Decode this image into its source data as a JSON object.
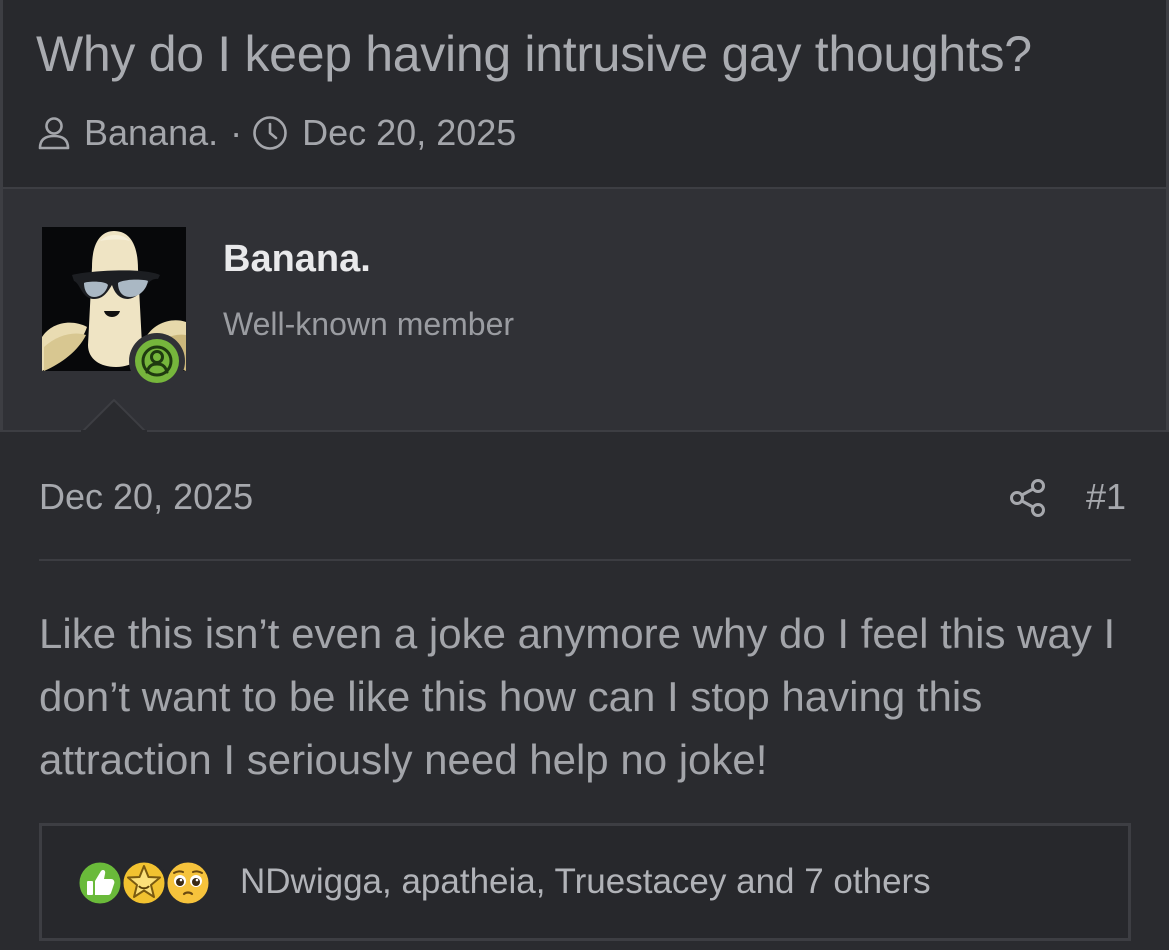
{
  "thread": {
    "title": "Why do I keep having intrusive gay thoughts?",
    "author": "Banana.",
    "separator": "·",
    "date": "Dec 20, 2025"
  },
  "user": {
    "name": "Banana.",
    "title": "Well-known member",
    "status": "online"
  },
  "post": {
    "date": "Dec 20, 2025",
    "number": "#1",
    "body": "Like this isn’t even a joke anymore why do I feel this way I don’t want to be like this how can I stop having this attraction I seriously need help no joke!"
  },
  "reactions": {
    "text": "NDwigga, apatheia, Truestacey and 7 others",
    "icons": [
      "thumbs-up-icon",
      "star-face-icon",
      "pleading-face-icon"
    ]
  },
  "colors": {
    "background": "#2a2b2f",
    "online": "#76b63c",
    "like": "#6aba3a",
    "star": "#f2c230"
  }
}
